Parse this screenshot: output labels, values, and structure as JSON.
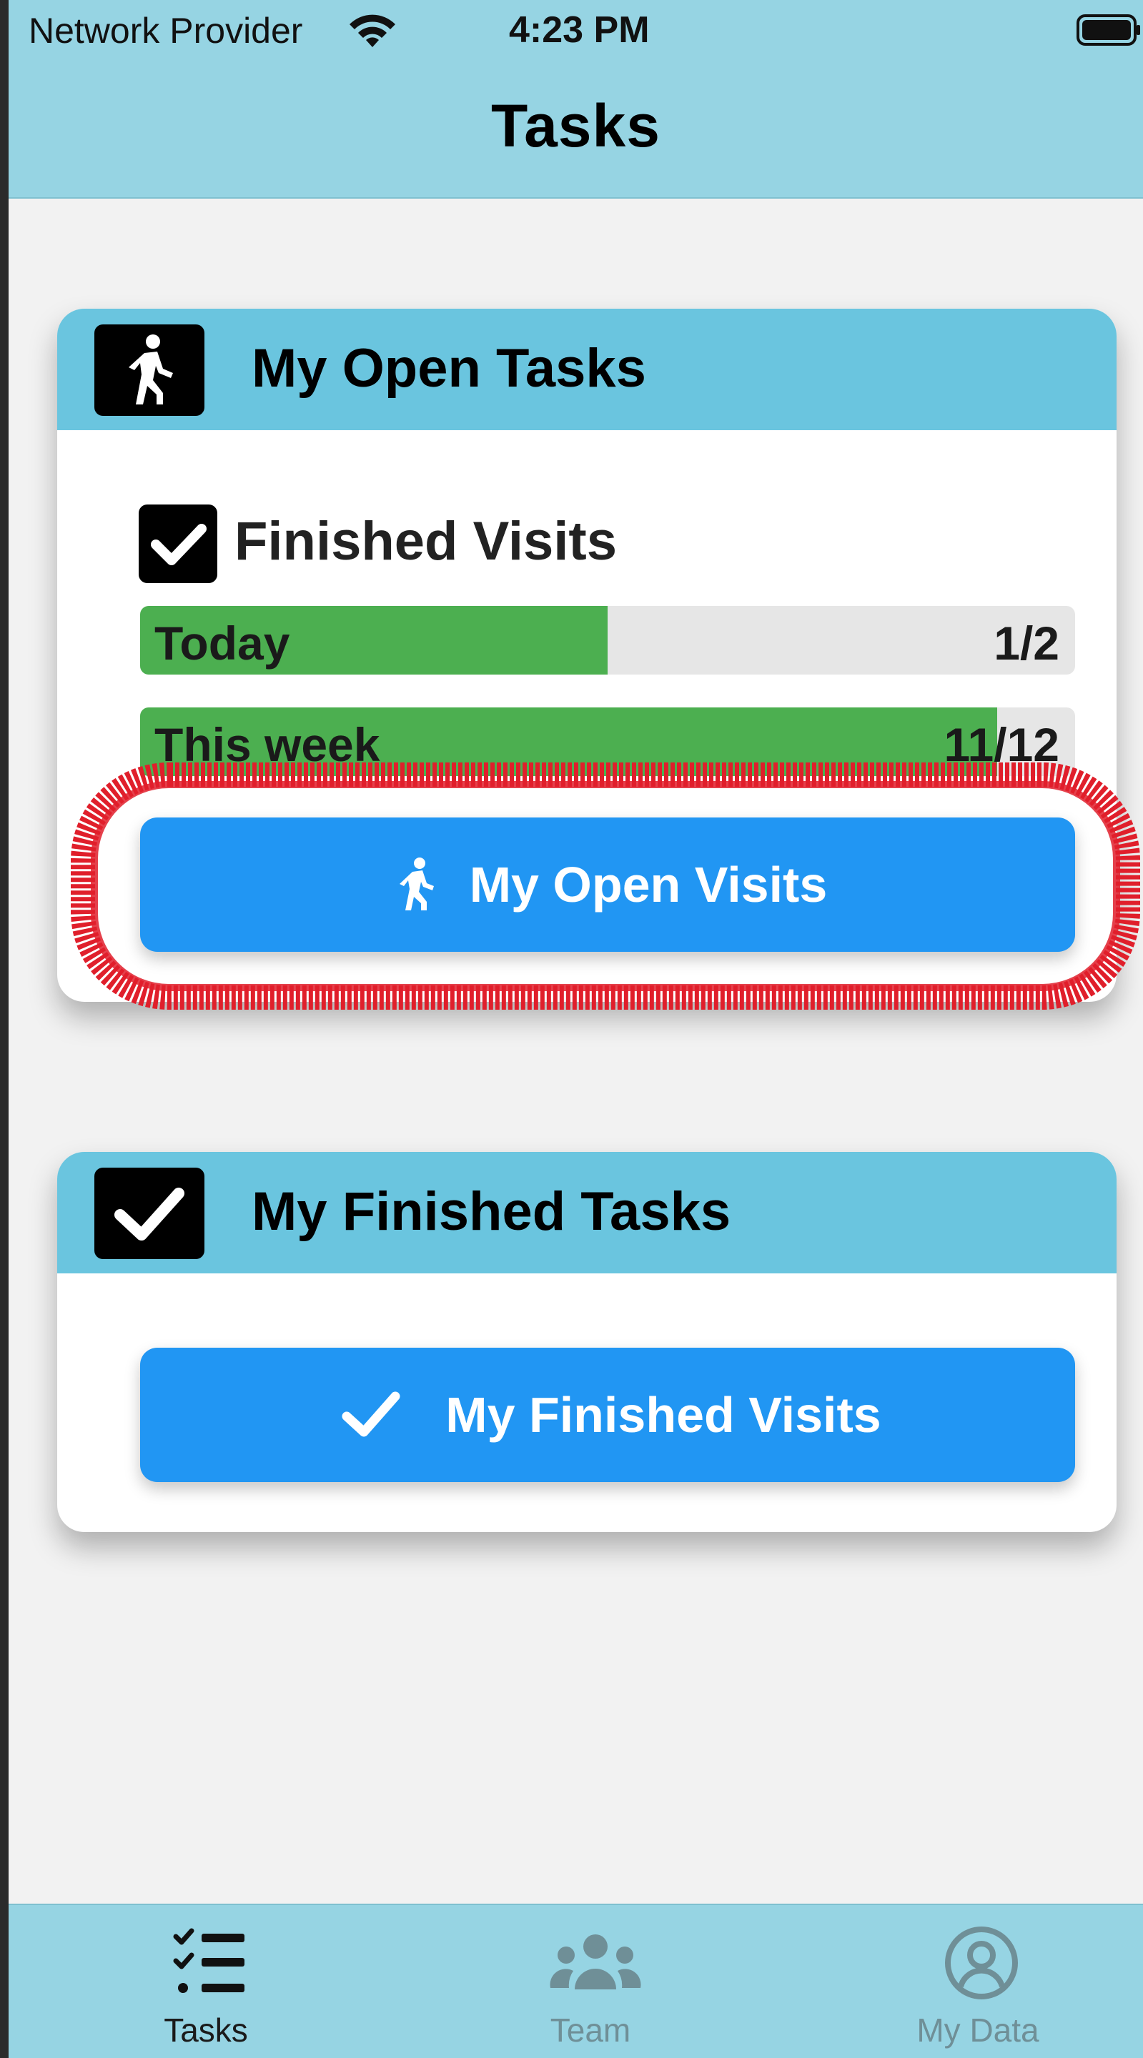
{
  "status_bar": {
    "carrier": "Network Provider",
    "time": "4:23 PM",
    "wifi_icon": "wifi-icon",
    "battery_icon": "battery-full-icon"
  },
  "header": {
    "title": "Tasks"
  },
  "open_tasks_card": {
    "title": "My Open Tasks",
    "icon": "walking-person-icon",
    "finished_visits": {
      "label": "Finished Visits",
      "icon": "checkbox-checked-icon",
      "progress": [
        {
          "label": "Today",
          "value_text": "1/2",
          "done": 1,
          "total": 2
        },
        {
          "label": "This week",
          "value_text": "11/12",
          "done": 11,
          "total": 12
        }
      ]
    },
    "button": {
      "label": "My Open Visits",
      "icon": "walking-person-icon"
    }
  },
  "finished_tasks_card": {
    "title": "My Finished Tasks",
    "icon": "checkbox-checked-icon",
    "button": {
      "label": "My Finished Visits",
      "icon": "checkmark-icon"
    }
  },
  "tabbar": {
    "tabs": [
      {
        "label": "Tasks",
        "icon": "task-list-icon",
        "active": true
      },
      {
        "label": "Team",
        "icon": "team-icon",
        "active": false
      },
      {
        "label": "My Data",
        "icon": "user-circle-icon",
        "active": false
      }
    ]
  },
  "colors": {
    "header_bg": "#96d4e3",
    "card_header_bg": "#6ac5df",
    "button_blue": "#2196f3",
    "progress_green": "#4caf50",
    "highlight_red": "#e01f2b"
  }
}
